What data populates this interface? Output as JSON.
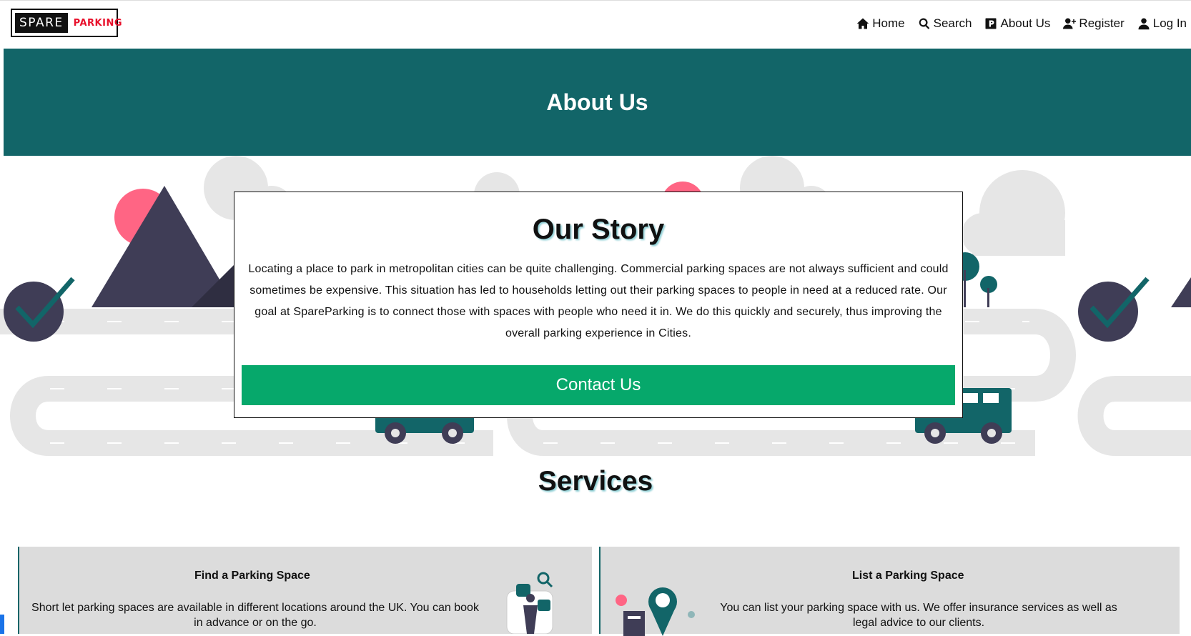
{
  "brand": {
    "spare": "SPARE",
    "parking": "PARKING"
  },
  "nav": {
    "items": [
      {
        "label": "Home",
        "icon": "home-icon"
      },
      {
        "label": "Search",
        "icon": "search-icon"
      },
      {
        "label": "About Us",
        "icon": "parking-icon"
      },
      {
        "label": "Register",
        "icon": "user-plus-icon"
      },
      {
        "label": "Log In",
        "icon": "user-icon"
      }
    ]
  },
  "hero": {
    "title": "About Us"
  },
  "story": {
    "title": "Our Story",
    "body": "Locating a place to park in metropolitan cities can be quite challenging. Commercial parking spaces are not always sufficient and could sometimes be expensive. This situation has led to households letting out their parking spaces to people in need at a reduced rate. Our goal at SpareParking is to connect those with spaces with people who need it in. We do this quickly and securely, thus improving the overall parking experience in Cities.",
    "button": "Contact Us"
  },
  "services": {
    "title": "Services",
    "cards": [
      {
        "title": "Find a Parking Space",
        "body": "Short let parking spaces are available in different locations around the UK. You can book in advance or on the go."
      },
      {
        "title": "List a Parking Space",
        "body": "You can list your parking space with us. We offer insurance services as well as legal advice to our clients."
      }
    ]
  },
  "colors": {
    "teal": "#126568",
    "green": "#06a86b",
    "brand_red": "#e8102b",
    "card_bg": "#dcdcdc",
    "illustration_dark": "#3f3d56",
    "illustration_pink": "#ff6584"
  }
}
